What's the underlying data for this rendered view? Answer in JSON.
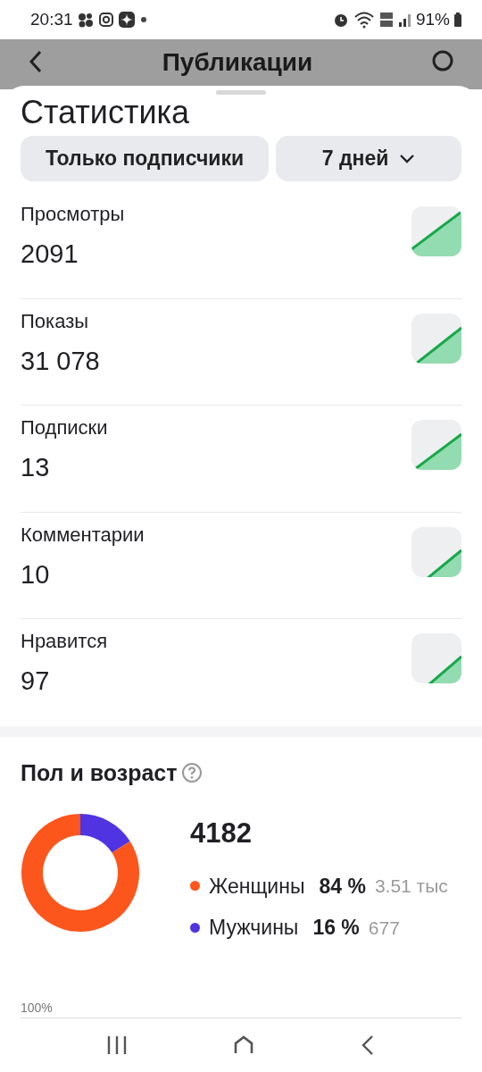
{
  "status_bar": {
    "time": "20:31",
    "battery": "91%"
  },
  "header": {
    "title": "Публикации"
  },
  "sheet": {
    "title": "Статистика",
    "filters": [
      {
        "label": "Только подписчики",
        "kind": "chip"
      },
      {
        "label": "7 дней",
        "kind": "dropdown"
      }
    ]
  },
  "metrics": [
    {
      "label": "Просмотры",
      "value": "2091"
    },
    {
      "label": "Показы",
      "value": "31 078"
    },
    {
      "label": "Подписки",
      "value": "13"
    },
    {
      "label": "Комментарии",
      "value": "10"
    },
    {
      "label": "Нравится",
      "value": "97"
    }
  ],
  "gender_age": {
    "title": "Пол и возраст",
    "total": "4182",
    "legend": [
      {
        "percent": "84 %",
        "count": "3.51 тыс",
        "color": "#fc561c"
      },
      {
        "percent": "16 %",
        "count": "677",
        "color": "#5034e2"
      }
    ],
    "chart_data": {
      "type": "donut",
      "categories": [
        "Женщины",
        "Мужчины"
      ],
      "values": [
        84,
        16
      ]
    },
    "axis_label": "100%"
  }
}
